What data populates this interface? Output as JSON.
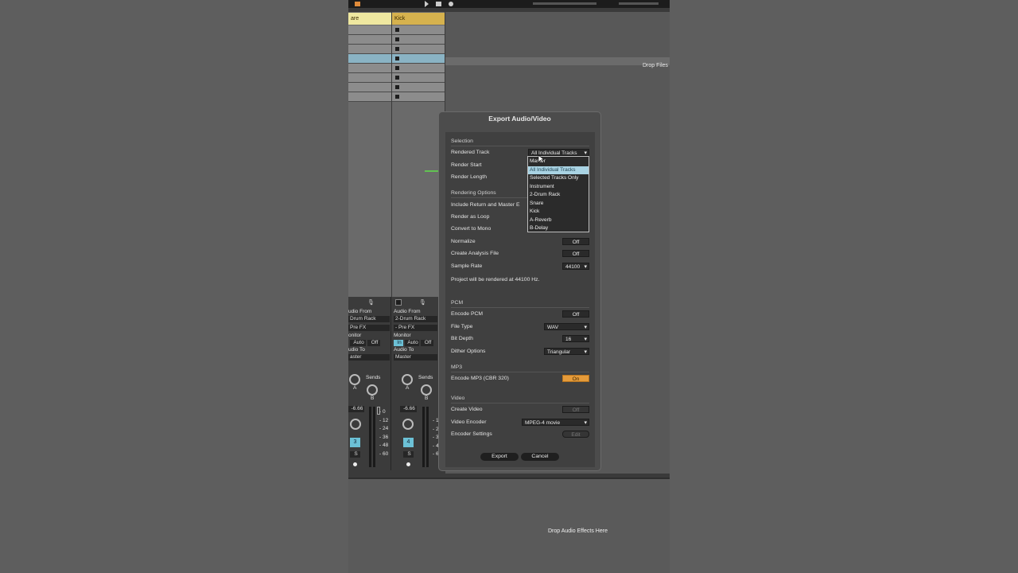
{
  "tracks": {
    "left_header": "are",
    "right_header": "Kick"
  },
  "drop_files": "Drop Files",
  "drop_audio_effects": "Drop Audio Effects Here",
  "mixer": {
    "left": {
      "audio_from": "udio From",
      "audio_from_value": "Drum Rack",
      "pre_fx": "Pre FX",
      "monitor": "onitor",
      "auto": "Auto",
      "off": "Off",
      "audio_to": "udio To",
      "audio_to_value": "aster",
      "sends": "Sends",
      "knob_a": "A",
      "knob_b": "B",
      "volume": "-6.66",
      "track_number": "3",
      "solo": "S"
    },
    "right": {
      "audio_from": "Audio From",
      "audio_from_value": "2-Drum Rack",
      "pre_fx": "- Pre FX",
      "monitor": "Monitor",
      "in": "In",
      "auto": "Auto",
      "off": "Off",
      "audio_to": "Audio To",
      "audio_to_value": "Master",
      "sends": "Sends",
      "knob_a": "A",
      "knob_b": "B",
      "volume": "-6.66",
      "track_number": "4",
      "solo": "S"
    },
    "db_scale": [
      "0",
      "12",
      "24",
      "36",
      "48",
      "60"
    ],
    "db_scale_right": [
      "1",
      "2",
      "3",
      "4",
      "6"
    ]
  },
  "dialog": {
    "title": "Export Audio/Video",
    "selection": {
      "heading": "Selection",
      "rendered_track_label": "Rendered Track",
      "rendered_track_value": "All Individual Tracks",
      "render_start_label": "Render Start",
      "render_length_label": "Render Length"
    },
    "rendering_options": {
      "heading": "Rendering Options",
      "include_return_label": "Include Return and Master E",
      "render_as_loop_label": "Render as Loop",
      "convert_to_mono_label": "Convert to Mono",
      "normalize_label": "Normalize",
      "normalize_value": "Off",
      "create_analysis_label": "Create Analysis File",
      "create_analysis_value": "Off",
      "sample_rate_label": "Sample Rate",
      "sample_rate_value": "44100",
      "info": "Project will be rendered at 44100 Hz."
    },
    "pcm": {
      "heading": "PCM",
      "encode_pcm_label": "Encode PCM",
      "encode_pcm_value": "Off",
      "file_type_label": "File Type",
      "file_type_value": "WAV",
      "bit_depth_label": "Bit Depth",
      "bit_depth_value": "16",
      "dither_label": "Dither Options",
      "dither_value": "Triangular"
    },
    "mp3": {
      "heading": "MP3",
      "encode_mp3_label": "Encode MP3 (CBR 320)",
      "encode_mp3_value": "On"
    },
    "video": {
      "heading": "Video",
      "create_video_label": "Create Video",
      "create_video_value": "Off",
      "video_encoder_label": "Video Encoder",
      "video_encoder_value": "MPEG-4 movie",
      "encoder_settings_label": "Encoder Settings",
      "encoder_settings_value": "Edit"
    },
    "export_button": "Export",
    "cancel_button": "Cancel"
  },
  "track_dropdown": {
    "options": [
      "Master",
      "All Individual Tracks",
      "Selected Tracks Only",
      "Instrument",
      "2-Drum Rack",
      "Snare",
      "Kick",
      "A-Reverb",
      "B-Delay"
    ],
    "highlighted_index": 1
  },
  "colors": {
    "clip_header": "#d6b24e",
    "left_header": "#efe8a0",
    "selected_slot": "#8ab3c4",
    "on_button": "#e59b3a",
    "highlight": "#a9d3e3",
    "arrow": "#5fe04a",
    "track_number": "#6cc1d6"
  }
}
